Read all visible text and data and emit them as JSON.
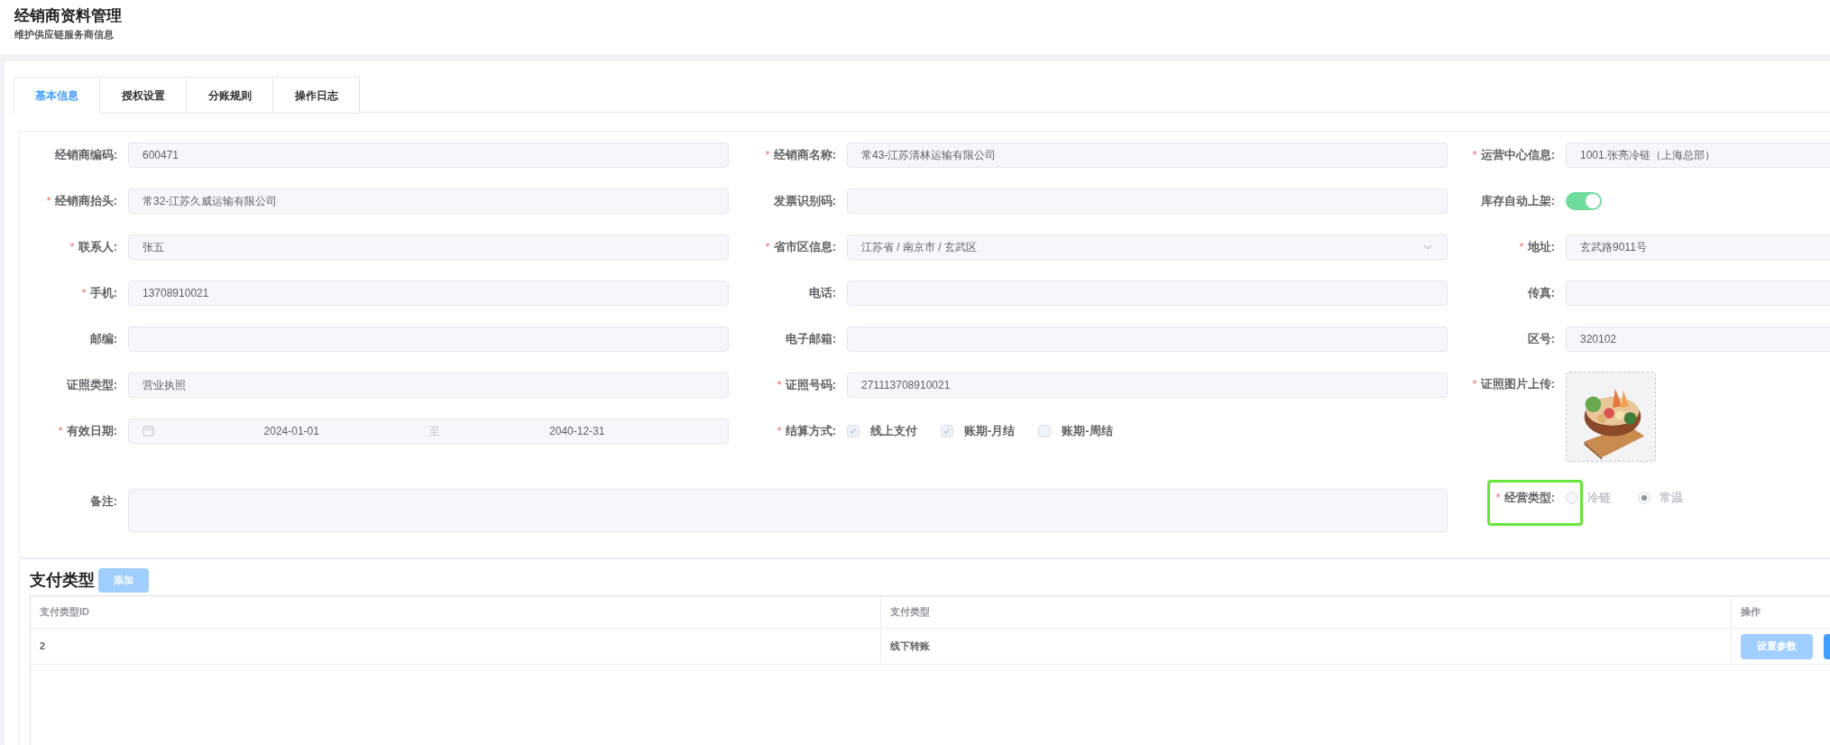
{
  "page": {
    "title": "经销商资料管理",
    "subtitle": "维护供应链服务商信息"
  },
  "tabs": [
    {
      "label": "基本信息",
      "selected": true
    },
    {
      "label": "授权设置",
      "selected": false
    },
    {
      "label": "分账规则",
      "selected": false
    },
    {
      "label": "操作日志",
      "selected": false
    }
  ],
  "form": {
    "fields": [
      {
        "kind": "input",
        "label": "经销商编码:",
        "value": "600471"
      },
      {
        "kind": "input",
        "required_mark": "*",
        "label": "经销商名称:",
        "value": "常43-江苏清林运输有限公司"
      },
      {
        "kind": "input",
        "required_mark": "*",
        "label": "运营中心信息:",
        "value": "1001.张亮冷链（上海总部）"
      },
      {
        "kind": "input",
        "required_mark": "*",
        "label": "经销商抬头:",
        "value": "常32-江苏久威运输有限公司"
      },
      {
        "kind": "input",
        "label": "发票识别码:"
      },
      {
        "kind": "toggle",
        "label": "库存自动上架:",
        "on": true
      },
      {
        "kind": "input",
        "required_mark": "*",
        "label": "联系人:",
        "value": "张五"
      },
      {
        "kind": "select",
        "required_mark": "*",
        "label": "省市区信息:",
        "value": "江苏省 / 南京市 / 玄武区"
      },
      {
        "kind": "input",
        "required_mark": "*",
        "label": "地址:",
        "value": "玄武路9011号"
      },
      {
        "kind": "input",
        "required_mark": "*",
        "label": "手机:",
        "value": "13708910021"
      },
      {
        "kind": "input",
        "label": "电话:"
      },
      {
        "kind": "input",
        "label": "传真:"
      },
      {
        "kind": "input",
        "label": "邮编:"
      },
      {
        "kind": "input",
        "label": "电子邮箱:"
      },
      {
        "kind": "input",
        "label": "区号:",
        "value": "320102"
      },
      {
        "kind": "input",
        "label": "证照类型:",
        "value": "营业执照"
      },
      {
        "kind": "input",
        "required_mark": "*",
        "label": "证照号码:",
        "value": "271113708910021"
      },
      {
        "required_mark": "*",
        "label": "证照图片上传:"
      },
      {
        "kind": "daterange",
        "required_mark": "*",
        "label": "有效日期:",
        "start": "2024-01-01",
        "separator": "至",
        "end": "2040-12-31"
      },
      {
        "kind": "checkboxes",
        "required_mark": "*",
        "label": "结算方式:",
        "disabled": true,
        "options": [
          {
            "label": "线上支付",
            "checked": true
          },
          {
            "label": "账期-月结",
            "checked": true
          },
          {
            "label": "账期-周结",
            "checked": false
          }
        ]
      },
      {
        "kind": "textarea",
        "label": "备注:"
      },
      {
        "kind": "radio",
        "required_mark": "*",
        "label": "经营类型:",
        "disabled": true,
        "highlighted": true,
        "options": [
          {
            "label": "冷链",
            "selected": false
          },
          {
            "label": "常温",
            "selected": true
          }
        ]
      }
    ]
  },
  "payment": {
    "title": "支付类型",
    "add_button": "添加",
    "columns": [
      "支付类型ID",
      "支付类型",
      "操作"
    ],
    "rows": [
      {
        "cells": [
          "2",
          "线下转账"
        ],
        "actions": [
          "设置参数"
        ]
      }
    ]
  }
}
